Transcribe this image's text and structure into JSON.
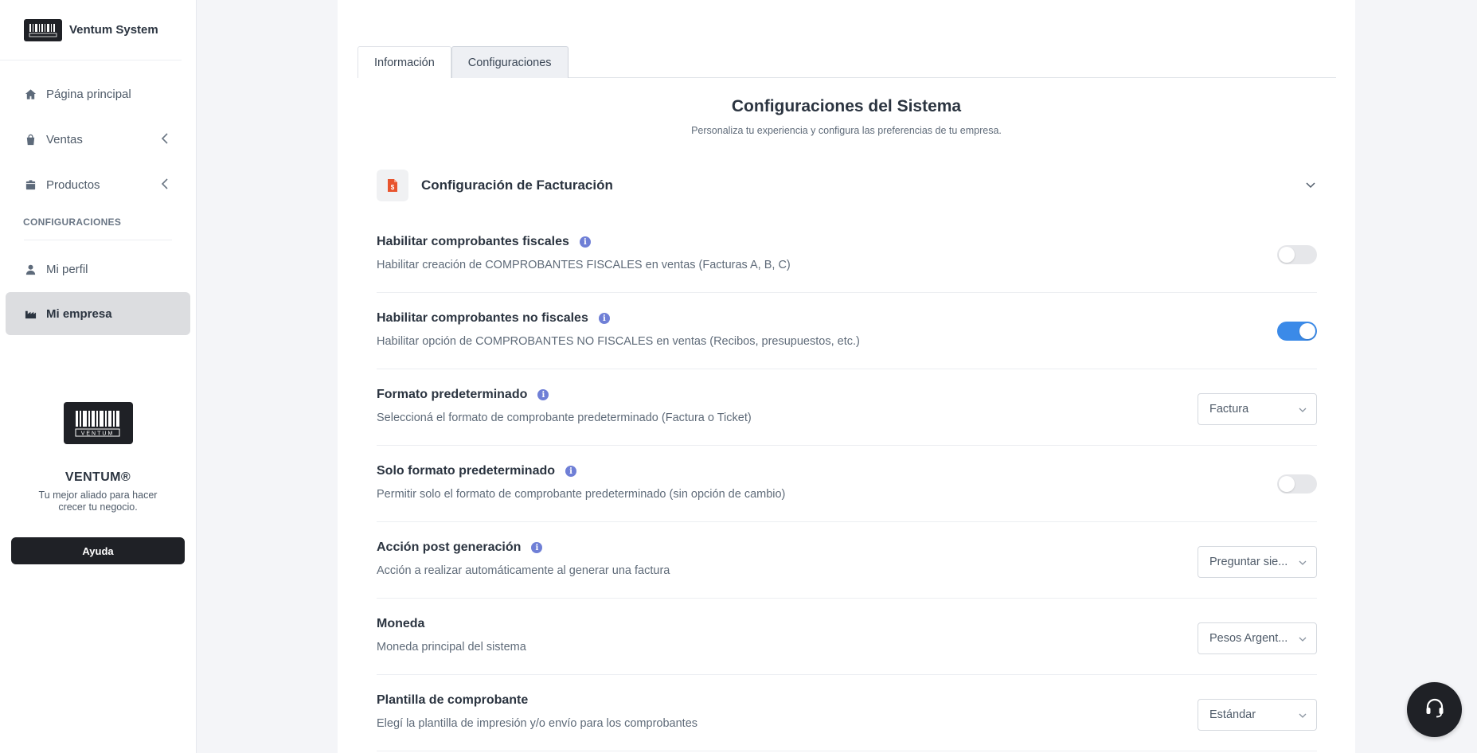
{
  "app": {
    "title": "Ventum System",
    "logo_text": "VENTUM"
  },
  "sidebar": {
    "items": [
      {
        "label": "Página principal",
        "icon": "home-icon"
      },
      {
        "label": "Ventas",
        "icon": "shopping-bag-icon"
      },
      {
        "label": "Productos",
        "icon": "box-icon"
      }
    ],
    "section_label": "CONFIGURACIONES",
    "config_items": [
      {
        "label": "Mi perfil",
        "icon": "user-icon"
      },
      {
        "label": "Mi empresa",
        "icon": "factory-icon",
        "active": true
      }
    ],
    "promo": {
      "title": "VENTUM®",
      "text": "Tu mejor aliado para hacer crecer tu negocio.",
      "button": "Ayuda"
    }
  },
  "tabs": [
    {
      "label": "Información",
      "active": false
    },
    {
      "label": "Configuraciones",
      "active": true
    }
  ],
  "main": {
    "title": "Configuraciones del Sistema",
    "subtitle": "Personaliza tu experiencia y configura las preferencias de tu empresa.",
    "group_title": "Configuración de Facturación",
    "settings": [
      {
        "label": "Habilitar comprobantes fiscales",
        "desc": "Habilitar creación de COMPROBANTES FISCALES en ventas (Facturas A, B, C)",
        "control": "toggle",
        "on": false,
        "info": true
      },
      {
        "label": "Habilitar comprobantes no fiscales",
        "desc": "Habilitar opción de COMPROBANTES NO FISCALES en ventas (Recibos, presupuestos, etc.)",
        "control": "toggle",
        "on": true,
        "info": true
      },
      {
        "label": "Formato predeterminado",
        "desc": "Seleccioná el formato de comprobante predeterminado (Factura o Ticket)",
        "control": "select",
        "value": "Factura",
        "info": true
      },
      {
        "label": "Solo formato predeterminado",
        "desc": "Permitir solo el formato de comprobante predeterminado (sin opción de cambio)",
        "control": "toggle",
        "on": false,
        "info": true
      },
      {
        "label": "Acción post generación",
        "desc": "Acción a realizar automáticamente al generar una factura",
        "control": "select",
        "value": "Preguntar sie...",
        "info": true
      },
      {
        "label": "Moneda",
        "desc": "Moneda principal del sistema",
        "control": "select",
        "value": "Pesos Argent...",
        "info": false
      },
      {
        "label": "Plantilla de comprobante",
        "desc": "Elegí la plantilla de impresión y/o envío para los comprobantes",
        "control": "select",
        "value": "Estándar",
        "info": false
      }
    ]
  },
  "colors": {
    "accent": "#3b8ae8",
    "info": "#6f7fd6",
    "dark": "#1f2126",
    "invoice_icon": "#e8542e"
  }
}
